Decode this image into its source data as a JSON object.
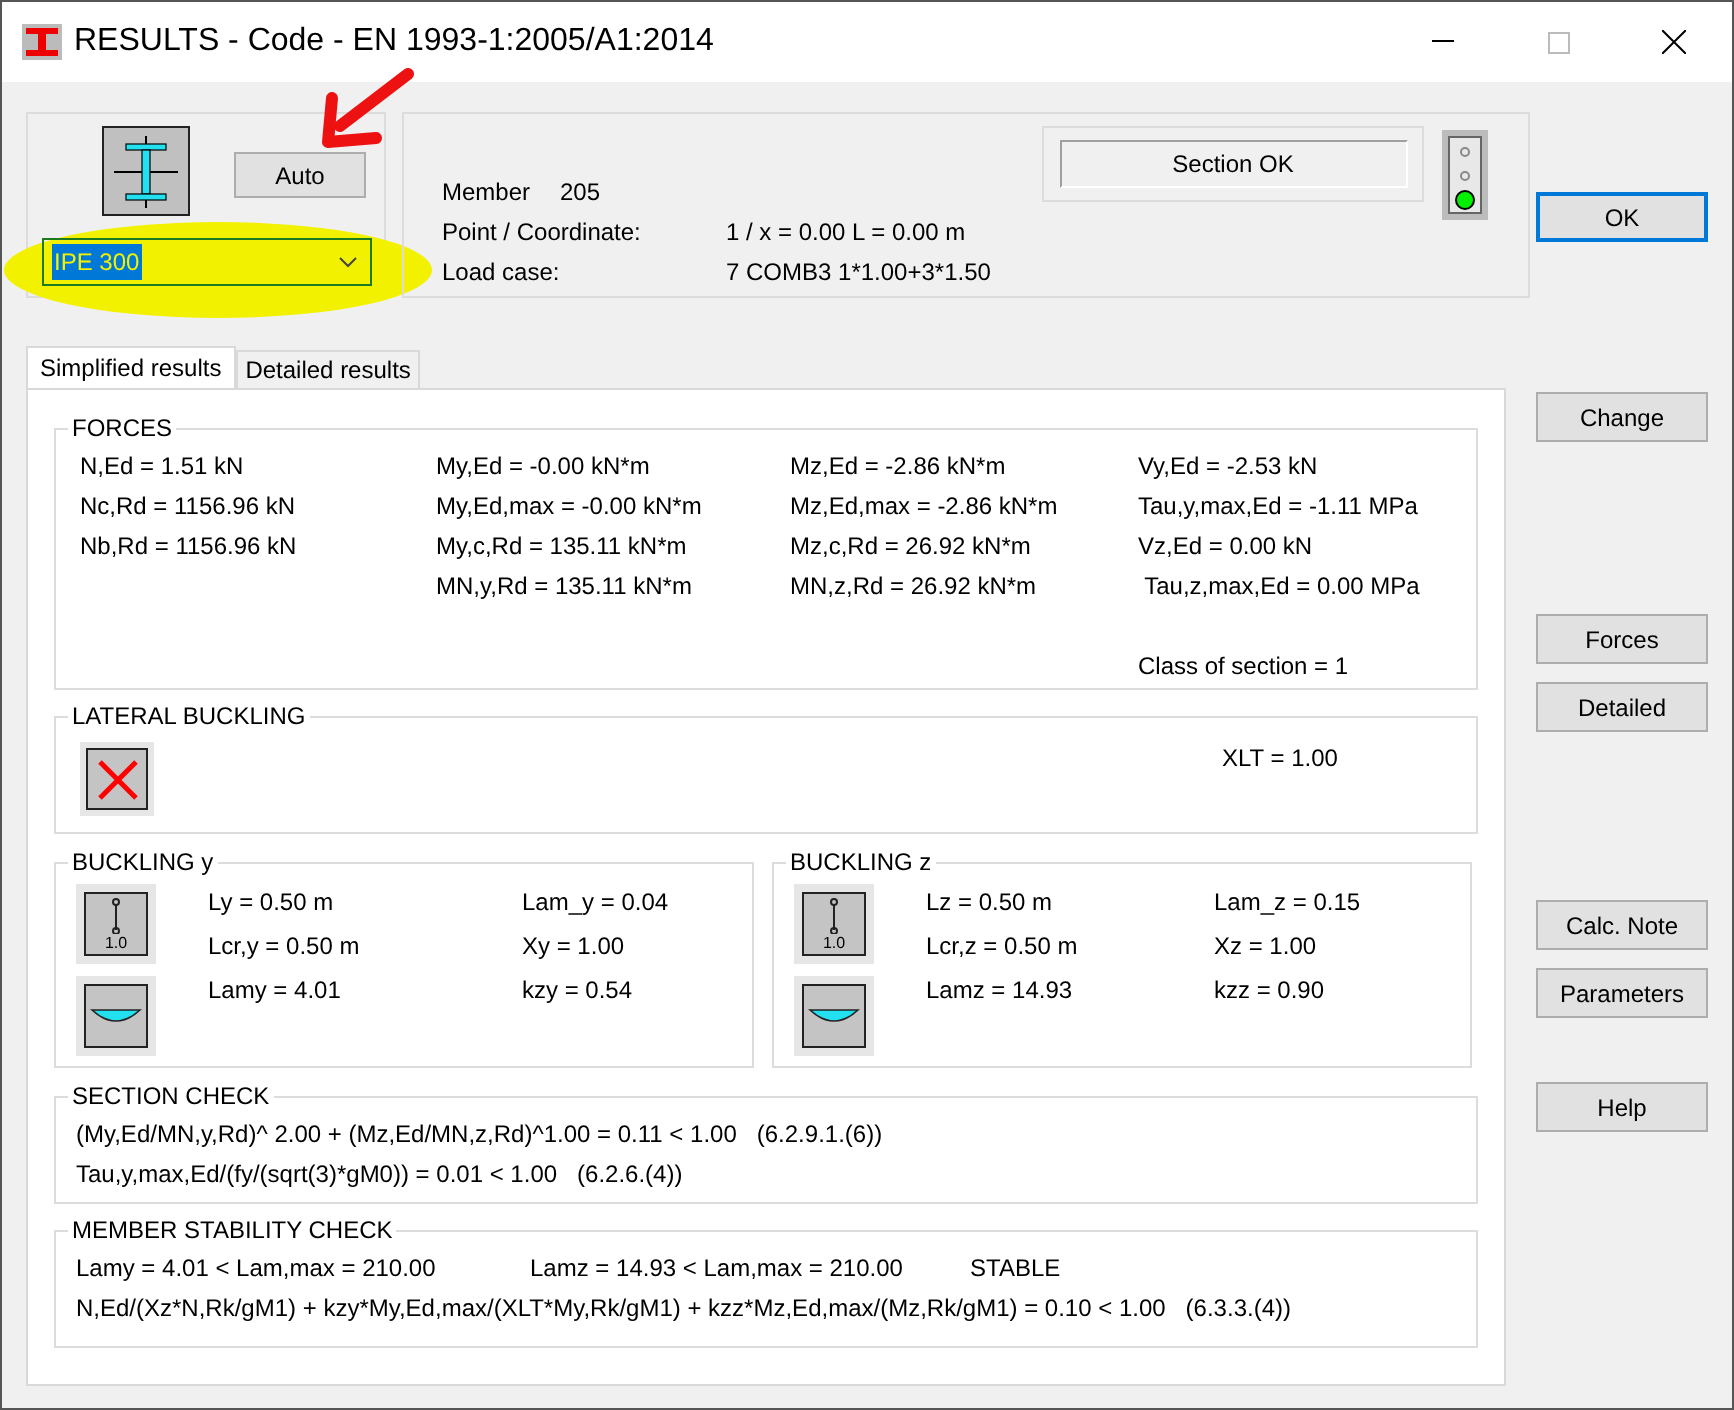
{
  "window": {
    "title": "RESULTS - Code - EN 1993-1:2005/A1:2014"
  },
  "section": {
    "value": "IPE 300",
    "auto_button": "Auto"
  },
  "info": [
    {
      "label": "Member",
      "value": "205"
    },
    {
      "label": "Point / Coordinate:",
      "value": "1 / x = 0.00 L = 0.00 m"
    },
    {
      "label": "Load case:",
      "value": "7 COMB3  1*1.00+3*1.50"
    }
  ],
  "status": {
    "text": "Section OK"
  },
  "side_buttons": [
    {
      "label": "OK",
      "default": true
    },
    {
      "label": "Change",
      "default": false
    },
    {
      "label": "Forces",
      "default": false
    },
    {
      "label": "Detailed",
      "default": false
    },
    {
      "label": "Calc. Note",
      "default": false
    },
    {
      "label": "Parameters",
      "default": false
    },
    {
      "label": "Help",
      "default": false
    }
  ],
  "tabs": [
    {
      "label": "Simplified results",
      "selected": true
    },
    {
      "label": "Detailed results",
      "selected": false
    }
  ],
  "forces": {
    "title": "FORCES",
    "columns": [
      [
        "N,Ed = 1.51 kN",
        "Nc,Rd = 1156.96 kN",
        "Nb,Rd = 1156.96 kN"
      ],
      [
        "My,Ed = -0.00 kN*m",
        "My,Ed,max = -0.00 kN*m",
        "My,c,Rd = 135.11 kN*m",
        "MN,y,Rd = 135.11 kN*m"
      ],
      [
        "Mz,Ed = -2.86 kN*m",
        "Mz,Ed,max = -2.86 kN*m",
        "Mz,c,Rd = 26.92 kN*m",
        "MN,z,Rd = 26.92 kN*m"
      ],
      [
        "Vy,Ed = -2.53 kN",
        "Tau,y,max,Ed = -1.11 MPa",
        "Vz,Ed = 0.00 kN",
        " Tau,z,max,Ed = 0.00 MPa"
      ]
    ],
    "class_text": "Class of section = 1"
  },
  "lateral": {
    "title": "LATERAL BUCKLING",
    "xlt": "XLT = 1.00"
  },
  "buckling": [
    {
      "title": "BUCKLING y",
      "factor": "1.0",
      "left": [
        "Ly = 0.50 m",
        "Lcr,y = 0.50 m",
        "Lamy = 4.01"
      ],
      "right": [
        "Lam_y = 0.04",
        "Xy = 1.00",
        "kzy = 0.54"
      ]
    },
    {
      "title": "BUCKLING z",
      "factor": "1.0",
      "left": [
        "Lz = 0.50 m",
        "Lcr,z = 0.50 m",
        "Lamz = 14.93"
      ],
      "right": [
        "Lam_z = 0.15",
        "Xz = 1.00",
        "kzz = 0.90"
      ]
    }
  ],
  "section_check": {
    "title": "SECTION CHECK",
    "lines": [
      "(My,Ed/MN,y,Rd)^ 2.00 + (Mz,Ed/MN,z,Rd)^1.00 = 0.11 < 1.00   (6.2.9.1.(6))",
      "Tau,y,max,Ed/(fy/(sqrt(3)*gM0)) = 0.01 < 1.00   (6.2.6.(4))"
    ]
  },
  "stability_check": {
    "title": "MEMBER STABILITY CHECK",
    "parts": [
      "Lamy = 4.01 < Lam,max = 210.00",
      "Lamz = 14.93 < Lam,max = 210.00",
      "STABLE"
    ],
    "formula": "N,Ed/(Xz*N,Rk/gM1) + kzy*My,Ed,max/(XLT*My,Rk/gM1) + kzz*Mz,Ed,max/(Mz,Rk/gM1) = 0.10 < 1.00   (6.3.3.(4))"
  }
}
